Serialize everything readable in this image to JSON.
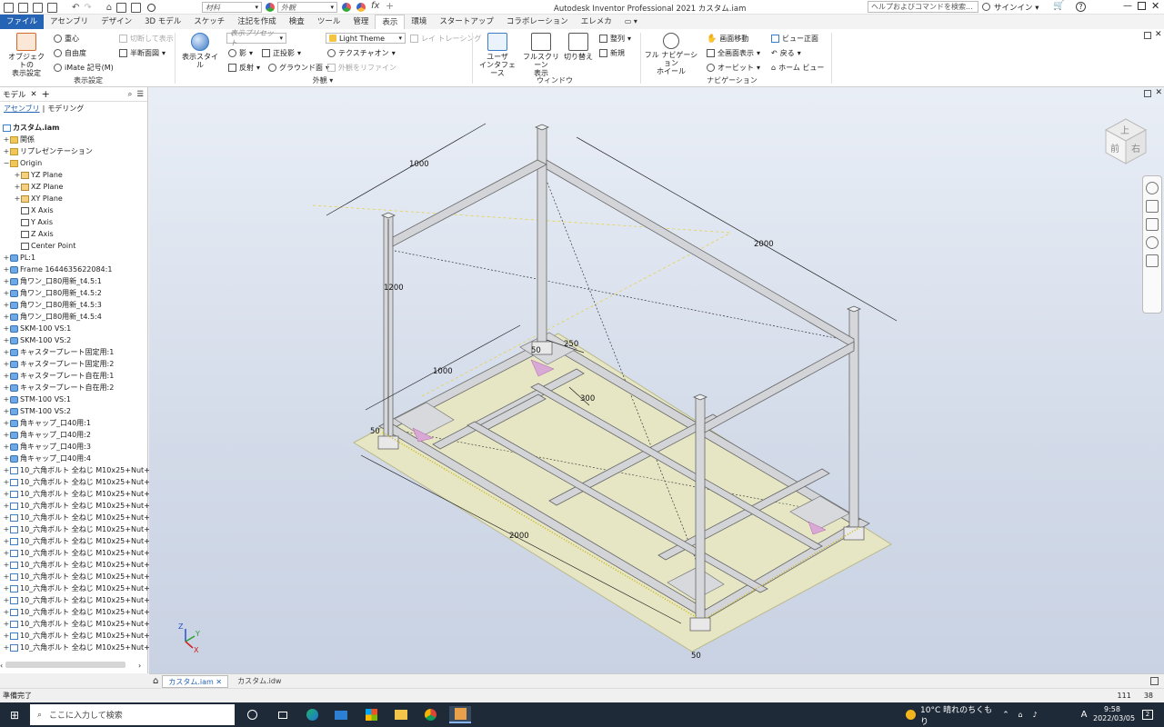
{
  "titlebar": {
    "material_label": "材料",
    "appearance_label": "外観",
    "app_title": "Autodesk Inventor Professional 2021   カスタム.iam",
    "help_search_placeholder": "ヘルプおよびコマンドを検索...",
    "signin_label": "サインイン"
  },
  "menu": {
    "tabs": [
      "ファイル",
      "アセンブリ",
      "デザイン",
      "3D モデル",
      "スケッチ",
      "注記を作成",
      "検査",
      "ツール",
      "管理",
      "表示",
      "環境",
      "スタートアップ",
      "コラボレーション",
      "エレメカ"
    ],
    "active_index": 9
  },
  "ribbon": {
    "object_visibility": "オブジェクトの\n表示設定",
    "center_of_gravity": "重心",
    "dof": "自由度",
    "imate_glyph": "iMate 記号(M)",
    "half_section": "切断して表示",
    "half_section_view": "半断面図",
    "visibility_group": "表示設定",
    "visual_style": "表示スタイル",
    "view_preset_placeholder": "表示プリセット",
    "shadows": "影",
    "reflections": "反射",
    "projection": "正投影",
    "ground_plane": "グラウンド面",
    "theme": "Light Theme",
    "texture_on": "テクスチャオン",
    "refine_appearance": "外観をリファイン",
    "ray_tracing": "レイ トレーシング",
    "appearance_group": "外観",
    "user_interface": "ユーザ\nインタフェース",
    "fullscreen": "フルスクリーン\n表示",
    "switch": "切り替え",
    "arrange": "整列",
    "new_window": "新規",
    "window_group": "ウィンドウ",
    "full_nav_wheel": "フル ナビゲーション\nホイール",
    "pan": "画面移動",
    "zoom_all": "全画面表示",
    "orbit": "オービット",
    "look_at": "ビュー正面",
    "back": "戻る",
    "home_view": "ホーム ビュー",
    "navigation_group": "ナビゲーション"
  },
  "browser": {
    "tab_label": "モデル",
    "sub_assembly": "アセンブリ",
    "sub_modeling": "モデリング",
    "root": "カスタム.iam",
    "items": [
      {
        "label": "関係",
        "icon": "folder",
        "depth": 0,
        "exp": "+"
      },
      {
        "label": "リプレゼンテーション",
        "icon": "folder",
        "depth": 0,
        "exp": "+"
      },
      {
        "label": "Origin",
        "icon": "folder",
        "depth": 0,
        "exp": "−"
      },
      {
        "label": "YZ Plane",
        "icon": "plane",
        "depth": 1,
        "exp": "+"
      },
      {
        "label": "XZ Plane",
        "icon": "plane",
        "depth": 1,
        "exp": "+"
      },
      {
        "label": "XY Plane",
        "icon": "plane",
        "depth": 1,
        "exp": "+"
      },
      {
        "label": "X Axis",
        "icon": "axis",
        "depth": 1,
        "exp": ""
      },
      {
        "label": "Y Axis",
        "icon": "axis",
        "depth": 1,
        "exp": ""
      },
      {
        "label": "Z Axis",
        "icon": "axis",
        "depth": 1,
        "exp": ""
      },
      {
        "label": "Center Point",
        "icon": "axis",
        "depth": 1,
        "exp": ""
      },
      {
        "label": "PL:1",
        "icon": "part",
        "depth": 0,
        "exp": "+"
      },
      {
        "label": "Frame 1644635622084:1",
        "icon": "part",
        "depth": 0,
        "exp": "+"
      },
      {
        "label": "角ワン_口80用新_t4.5:1",
        "icon": "part",
        "depth": 0,
        "exp": "+"
      },
      {
        "label": "角ワン_口80用新_t4.5:2",
        "icon": "part",
        "depth": 0,
        "exp": "+"
      },
      {
        "label": "角ワン_口80用新_t4.5:3",
        "icon": "part",
        "depth": 0,
        "exp": "+"
      },
      {
        "label": "角ワン_口80用新_t4.5:4",
        "icon": "part",
        "depth": 0,
        "exp": "+"
      },
      {
        "label": "SKM-100 VS:1",
        "icon": "part",
        "depth": 0,
        "exp": "+"
      },
      {
        "label": "SKM-100 VS:2",
        "icon": "part",
        "depth": 0,
        "exp": "+"
      },
      {
        "label": "キャスタープレート固定用:1",
        "icon": "part",
        "depth": 0,
        "exp": "+"
      },
      {
        "label": "キャスタープレート固定用:2",
        "icon": "part",
        "depth": 0,
        "exp": "+"
      },
      {
        "label": "キャスタープレート自在用:1",
        "icon": "part",
        "depth": 0,
        "exp": "+"
      },
      {
        "label": "キャスタープレート自在用:2",
        "icon": "part",
        "depth": 0,
        "exp": "+"
      },
      {
        "label": "STM-100 VS:1",
        "icon": "part",
        "depth": 0,
        "exp": "+"
      },
      {
        "label": "STM-100 VS:2",
        "icon": "part",
        "depth": 0,
        "exp": "+"
      },
      {
        "label": "角キャップ_口40用:1",
        "icon": "part",
        "depth": 0,
        "exp": "+"
      },
      {
        "label": "角キャップ_口40用:2",
        "icon": "part",
        "depth": 0,
        "exp": "+"
      },
      {
        "label": "角キャップ_口40用:3",
        "icon": "part",
        "depth": 0,
        "exp": "+"
      },
      {
        "label": "角キャップ_口40用:4",
        "icon": "part",
        "depth": 0,
        "exp": "+"
      },
      {
        "label": "10_六角ボルト 全ねじ M10x25+Nut+su",
        "icon": "asm",
        "depth": 0,
        "exp": "+"
      },
      {
        "label": "10_六角ボルト 全ねじ M10x25+Nut+su",
        "icon": "asm",
        "depth": 0,
        "exp": "+"
      },
      {
        "label": "10_六角ボルト 全ねじ M10x25+Nut+su",
        "icon": "asm",
        "depth": 0,
        "exp": "+"
      },
      {
        "label": "10_六角ボルト 全ねじ M10x25+Nut+su",
        "icon": "asm",
        "depth": 0,
        "exp": "+"
      },
      {
        "label": "10_六角ボルト 全ねじ M10x25+Nut+su",
        "icon": "asm",
        "depth": 0,
        "exp": "+"
      },
      {
        "label": "10_六角ボルト 全ねじ M10x25+Nut+su",
        "icon": "asm",
        "depth": 0,
        "exp": "+"
      },
      {
        "label": "10_六角ボルト 全ねじ M10x25+Nut+su",
        "icon": "asm",
        "depth": 0,
        "exp": "+"
      },
      {
        "label": "10_六角ボルト 全ねじ M10x25+Nut+su",
        "icon": "asm",
        "depth": 0,
        "exp": "+"
      },
      {
        "label": "10_六角ボルト 全ねじ M10x25+Nut+su",
        "icon": "asm",
        "depth": 0,
        "exp": "+"
      },
      {
        "label": "10_六角ボルト 全ねじ M10x25+Nut+su",
        "icon": "asm",
        "depth": 0,
        "exp": "+"
      },
      {
        "label": "10_六角ボルト 全ねじ M10x25+Nut+su",
        "icon": "asm",
        "depth": 0,
        "exp": "+"
      },
      {
        "label": "10_六角ボルト 全ねじ M10x25+Nut+su",
        "icon": "asm",
        "depth": 0,
        "exp": "+"
      },
      {
        "label": "10_六角ボルト 全ねじ M10x25+Nut+su",
        "icon": "asm",
        "depth": 0,
        "exp": "+"
      },
      {
        "label": "10_六角ボルト 全ねじ M10x25+Nut+su",
        "icon": "asm",
        "depth": 0,
        "exp": "+"
      },
      {
        "label": "10_六角ボルト 全ねじ M10x25+Nut+su",
        "icon": "asm",
        "depth": 0,
        "exp": "+"
      },
      {
        "label": "10_六角ボルト 全ねじ M10x25+Nut+su",
        "icon": "asm",
        "depth": 0,
        "exp": "+"
      }
    ]
  },
  "viewcube": {
    "front": "前",
    "right": "右",
    "top": "上"
  },
  "dimensions": {
    "top_width": "1000",
    "top_length": "2000",
    "height": "1200",
    "base_width": "1000",
    "base_length": "2000",
    "offset_250": "250",
    "offset_300": "300",
    "offset_50a": "50",
    "offset_50b": "50",
    "offset_50c": "50"
  },
  "triad": {
    "x": "X",
    "y": "Y",
    "z": "Z"
  },
  "doc_tabs": {
    "active": "カスタム.iam",
    "other": "カスタム.idw"
  },
  "status": {
    "left": "準備完了",
    "count1": "111",
    "count2": "38"
  },
  "taskbar": {
    "search_placeholder": "ここに入力して検索",
    "weather": "10°C  晴れのちくもり",
    "ime": "A",
    "time": "9:58",
    "date": "2022/03/05",
    "notify": "2"
  },
  "colors": {
    "accent": "#2563b4",
    "floor": "#e6e6c4",
    "frame": "#d2d4d8",
    "marker": "#d9a9d6"
  }
}
